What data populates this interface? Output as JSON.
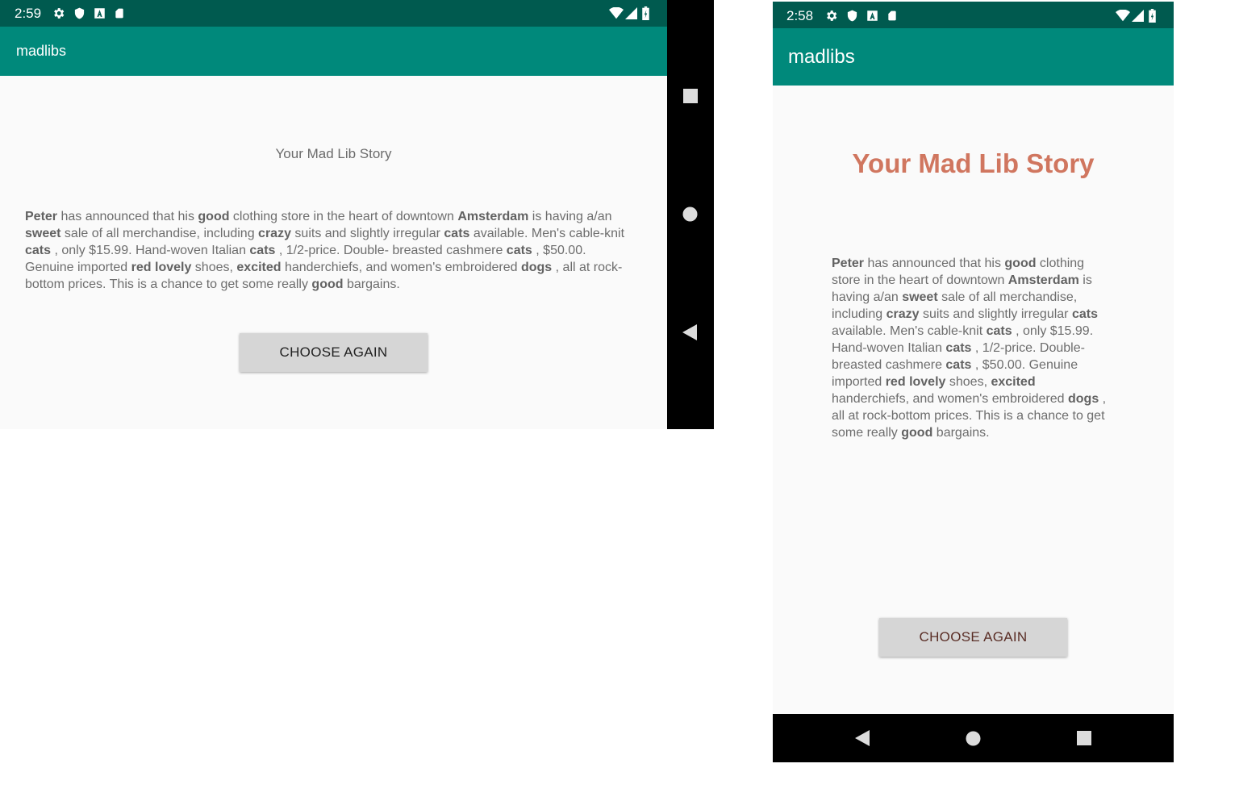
{
  "landscape": {
    "status": {
      "time": "2:59"
    },
    "appbar": {
      "title": "madlibs"
    },
    "story_title": "Your Mad Lib Story",
    "button_label": "CHOOSE AGAIN"
  },
  "portrait": {
    "status": {
      "time": "2:58"
    },
    "appbar": {
      "title": "madlibs"
    },
    "story_title": "Your Mad Lib Story",
    "button_label": "CHOOSE AGAIN"
  },
  "story": {
    "words": {
      "name": "Peter",
      "adj1": "good",
      "city": "Amsterdam",
      "adj2": "sweet",
      "adj3": "crazy",
      "noun": "cats",
      "color": "red",
      "adj4": "lovely",
      "adj5": "excited",
      "noun2": "dogs"
    },
    "text": {
      "t1": " has announced that his ",
      "t2": " clothing store in the heart of downtown ",
      "t3": " is having a/an ",
      "t4": " sale of all merchandise, including ",
      "t5": " suits and slightly irregular ",
      "t6": " available. Men's cable-knit ",
      "t7": " , only $15.99. Hand-woven Italian ",
      "t8": " , 1/2-price. Double- breasted cashmere ",
      "t9": " , $50.00. Genuine imported ",
      "t10": " ",
      "t11": " shoes, ",
      "t12": " handerchiefs, and women's embroidered ",
      "t13": " , all at rock-bottom prices. This is a chance to get some really ",
      "t14": " bargains."
    }
  },
  "icons": [
    "settings-icon",
    "shield-icon",
    "font-a-icon",
    "sd-card-icon",
    "wifi-icon",
    "signal-icon",
    "battery-icon",
    "recents-icon",
    "home-icon",
    "back-icon"
  ],
  "colors": {
    "status_bar": "#005a4f",
    "app_bar": "#00897b",
    "portrait_title": "#d0765f",
    "button": "#d6d6d6",
    "background": "#fafafa"
  }
}
